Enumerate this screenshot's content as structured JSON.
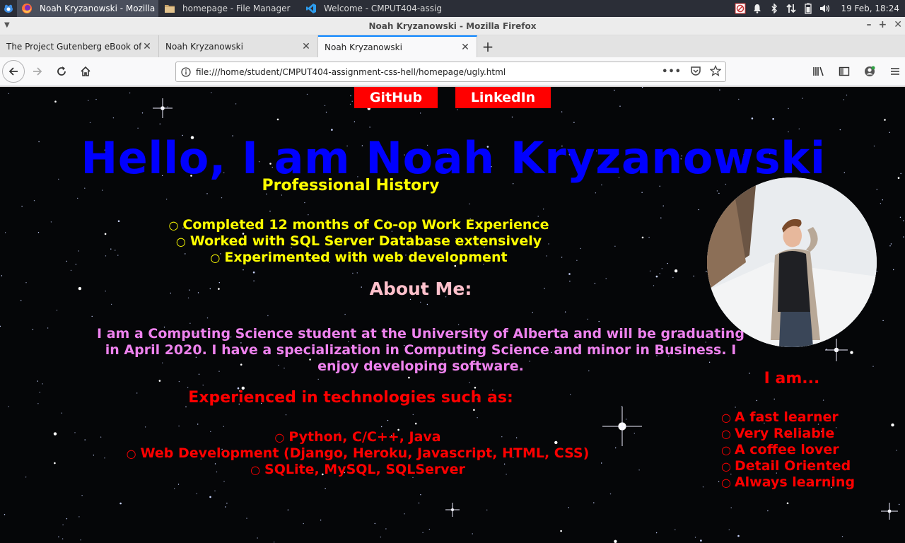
{
  "taskbar": {
    "tasks": [
      {
        "label": "Noah Kryzanowski - Mozilla F...",
        "icon": "firefox-icon",
        "active": true
      },
      {
        "label": "homepage - File Manager",
        "icon": "folder-icon",
        "active": false
      },
      {
        "label": "Welcome - CMPUT404-assig...",
        "icon": "vscode-icon",
        "active": false
      }
    ],
    "clock": "19 Feb, 18:24"
  },
  "window": {
    "title": "Noah Kryzanowski - Mozilla Firefox"
  },
  "tabs": [
    {
      "label": "The Project Gutenberg eBook of J",
      "selected": false
    },
    {
      "label": "Noah Kryzanowski",
      "selected": false
    },
    {
      "label": "Noah Kryzanowski",
      "selected": true
    }
  ],
  "urlbar": {
    "url": "file:///home/student/CMPUT404-assignment-css-hell/homepage/ugly.html"
  },
  "page": {
    "links": {
      "github": "GitHub",
      "linkedin": "LinkedIn"
    },
    "heading": "Hello, I am Noah Kryzanowski",
    "professional_history": {
      "title": "Professional History",
      "items": [
        "Completed 12 months of Co-op Work Experience",
        "Worked with SQL Server Database extensively",
        "Experimented with web development"
      ]
    },
    "about": {
      "title": "About Me:",
      "text": "I am a Computing Science student at the University of Alberta and will be graduating in April 2020. I have a specialization in Computing Science and minor in Business. I enjoy developing software."
    },
    "technologies": {
      "title": "Experienced in technologies such as:",
      "items": [
        "Python, C/C++, Java",
        "Web Development (Django, Heroku, Javascript, HTML, CSS)",
        "SQLite, MySQL, SQLServer"
      ]
    },
    "i_am": {
      "title": "I am...",
      "items": [
        "A fast learner",
        "Very Reliable",
        "A coffee lover",
        "Detail Oriented",
        "Always learning"
      ]
    },
    "colors": {
      "heading": "#0000ff",
      "professional": "#ffff00",
      "about_title": "#ffc0cb",
      "about_text": "#ee82ee",
      "tech": "#ff0000",
      "link_button": "#ff0000",
      "background": "#050608"
    }
  }
}
